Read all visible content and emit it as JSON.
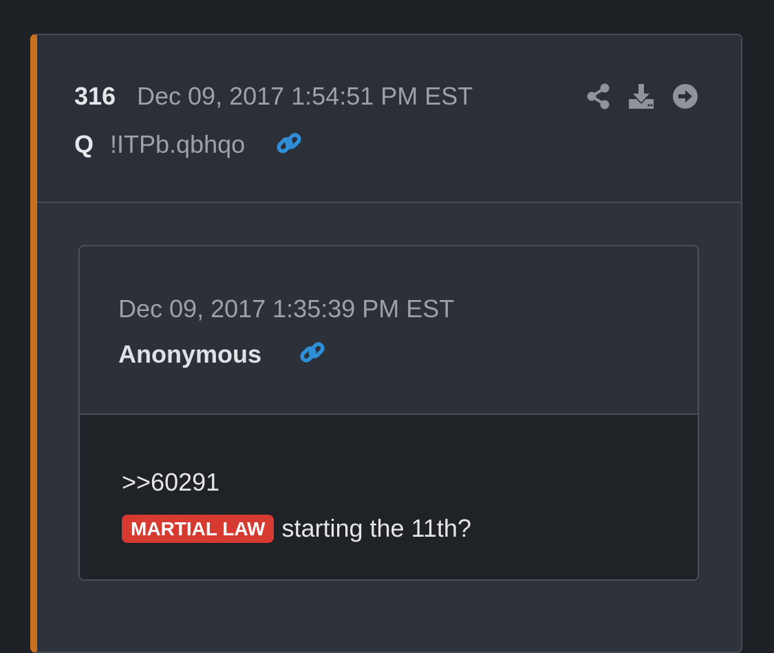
{
  "post": {
    "number": "316",
    "date": "Dec 09, 2017 1:54:51 PM EST",
    "author": "Q",
    "tripcode": "!ITPb.qbhqo"
  },
  "quoted": {
    "date": "Dec 09, 2017 1:35:39 PM EST",
    "author": "Anonymous",
    "reference": ">>60291",
    "tag": "MARTIAL LAW",
    "text": "starting the 11th?"
  },
  "colors": {
    "accent": "#c8701d",
    "link_icon": "#2f8fd6",
    "badge": "#d63a30"
  },
  "icons": [
    "share-icon",
    "download-icon",
    "arrow-right-circle-icon",
    "link-icon"
  ]
}
